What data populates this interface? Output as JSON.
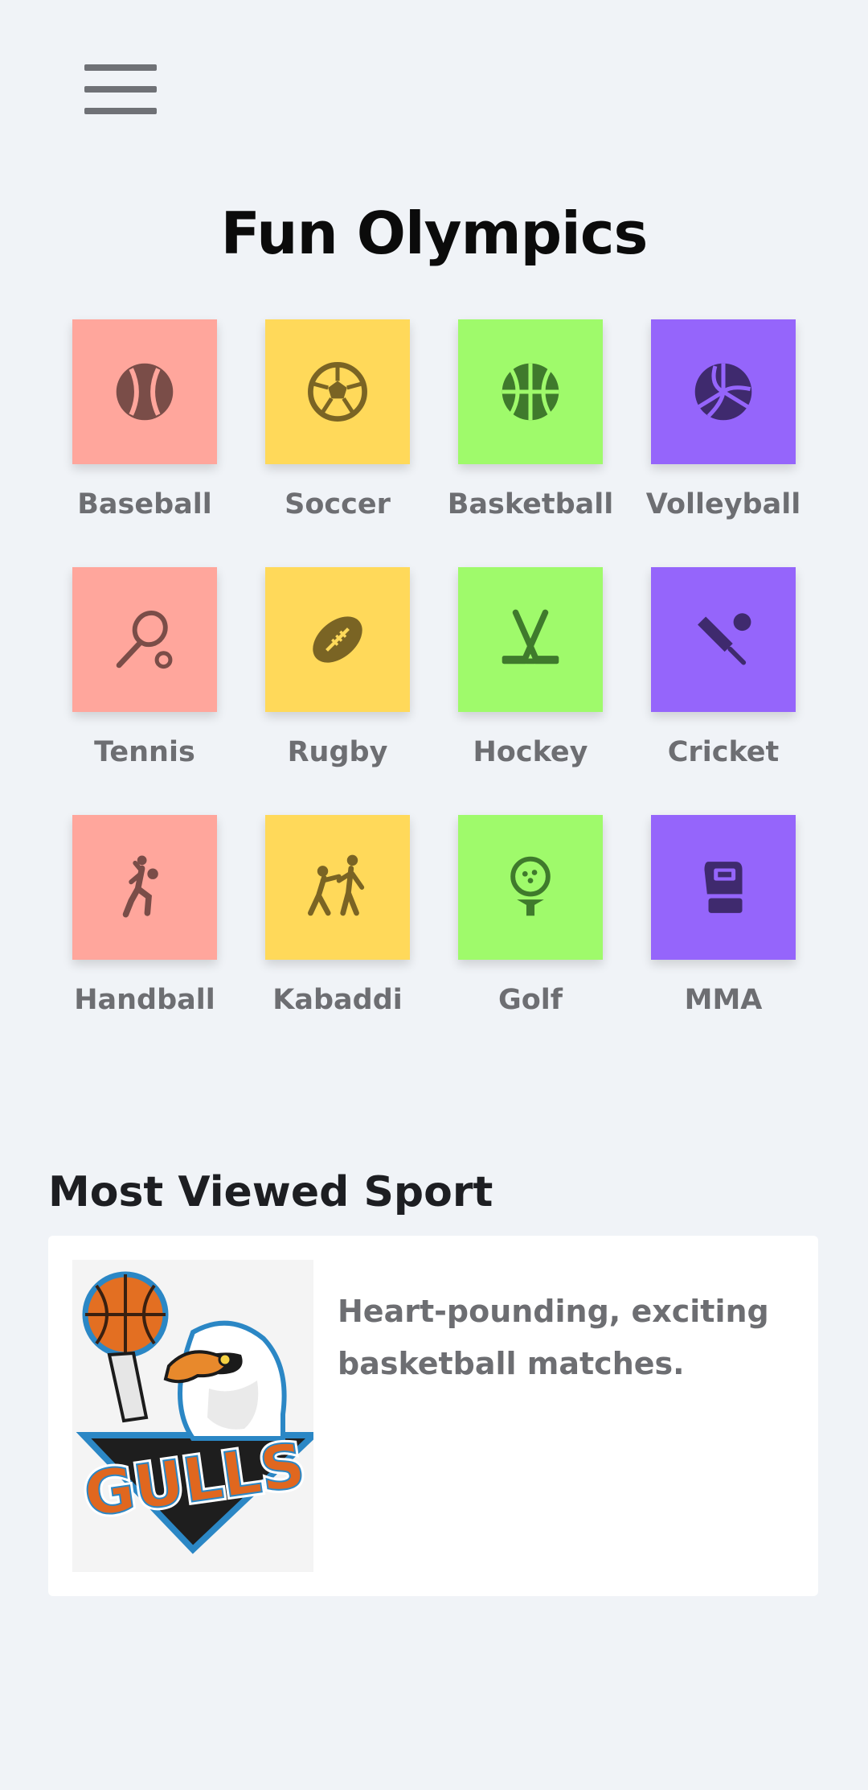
{
  "header": {
    "menu_icon": "hamburger-menu-icon"
  },
  "title": "Fun Olympics",
  "colors": {
    "pink": "#ffa69c",
    "yellow": "#ffd95a",
    "green": "#9ffa6b",
    "purple": "#9565fb"
  },
  "sports": [
    {
      "label": "Baseball",
      "icon": "baseball-icon",
      "color": "#ffa69c"
    },
    {
      "label": "Soccer",
      "icon": "soccer-ball-icon",
      "color": "#ffd95a"
    },
    {
      "label": "Basketball",
      "icon": "basketball-icon",
      "color": "#9ffa6b"
    },
    {
      "label": "Volleyball",
      "icon": "volleyball-icon",
      "color": "#9565fb"
    },
    {
      "label": "Tennis",
      "icon": "tennis-racket-icon",
      "color": "#ffa69c"
    },
    {
      "label": "Rugby",
      "icon": "rugby-ball-icon",
      "color": "#ffd95a"
    },
    {
      "label": "Hockey",
      "icon": "hockey-sticks-icon",
      "color": "#9ffa6b"
    },
    {
      "label": "Cricket",
      "icon": "cricket-bat-icon",
      "color": "#9565fb"
    },
    {
      "label": "Handball",
      "icon": "handball-player-icon",
      "color": "#ffa69c"
    },
    {
      "label": "Kabaddi",
      "icon": "kabaddi-players-icon",
      "color": "#ffd95a"
    },
    {
      "label": "Golf",
      "icon": "golf-ball-icon",
      "color": "#9ffa6b"
    },
    {
      "label": "MMA",
      "icon": "boxing-glove-icon",
      "color": "#9565fb"
    }
  ],
  "most_viewed": {
    "section_title": "Most Viewed Sport",
    "description": "Heart-pounding, exciting basketball matches.",
    "logo_text": "GULLS"
  }
}
